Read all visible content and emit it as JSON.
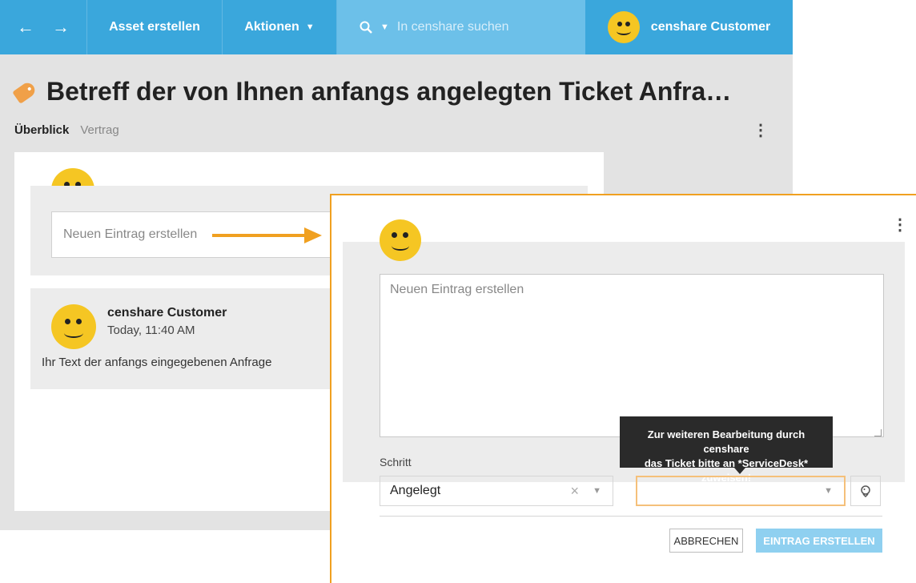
{
  "topbar": {
    "back_icon": "arrow-left-icon",
    "forward_icon": "arrow-right-icon",
    "asset_label": "Asset erstellen",
    "actions_label": "Aktionen",
    "search_placeholder": "In censhare suchen",
    "user_name": "censhare Customer"
  },
  "page": {
    "title": "Betreff der von Ihnen anfangs angelegten Ticket Anfra…",
    "tabs": [
      "Überblick",
      "Vertrag"
    ]
  },
  "feed": {
    "new_entry_placeholder": "Neuen Eintrag erstellen",
    "entry": {
      "author": "censhare Customer",
      "time": "Today, 11:40 AM",
      "text": "Ihr Text der anfangs eingegebenen Anfrage"
    }
  },
  "dialog": {
    "textarea_placeholder": "Neuen Eintrag erstellen",
    "tooltip_line1": "Zur weiteren Bearbeitung durch censhare",
    "tooltip_line2": "das Ticket bitte an *ServiceDesk* zuweisen!",
    "step_label": "Schritt",
    "step_value": "Angelegt",
    "cancel_label": "ABBRECHEN",
    "create_label": "EINTRAG ERSTELLEN"
  },
  "colors": {
    "topbar": "#3aa7dc",
    "search": "#6cc0e9",
    "accent_orange": "#f0a020",
    "smiley": "#f5c623",
    "create_button": "#8fd0f0"
  }
}
